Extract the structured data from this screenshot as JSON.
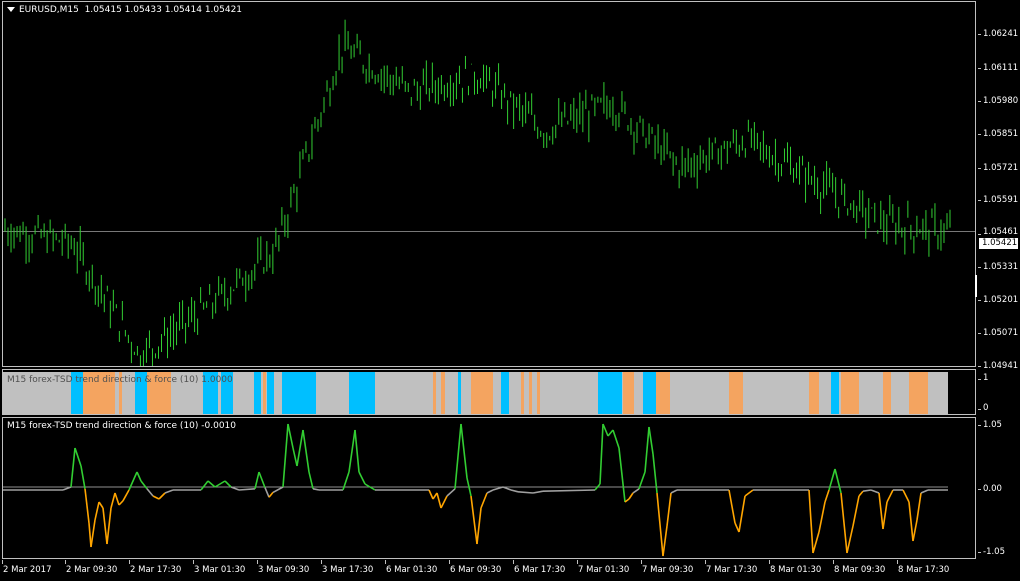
{
  "main_label": {
    "symbol": "EURUSD,M15",
    "ohlc": "1.05415 1.05433 1.05414 1.05421"
  },
  "price_axis": [
    "1.06241",
    "1.06111",
    "1.05980",
    "1.05851",
    "1.05721",
    "1.05591",
    "1.05461",
    "1.05331",
    "1.05201",
    "1.05071",
    "1.04941"
  ],
  "current_price": "1.05421",
  "indicator1": {
    "label": "M15 forex-TSD trend direction & force (10) 1.0000",
    "axis": [
      "1",
      "0"
    ],
    "colors": {
      "neutral": "#c0c0c0",
      "up": "#00bfff",
      "down": "#f4a460"
    }
  },
  "indicator2": {
    "label": "M15 forex-TSD trend direction & force (10) -0.0010",
    "axis": [
      "1.05",
      "0.00",
      "-1.05"
    ],
    "colors": {
      "up": "#32cd32",
      "down": "#ffa500",
      "neutral": "#a0a0a0"
    }
  },
  "time_axis": [
    "2 Mar 2017",
    "2 Mar 09:30",
    "2 Mar 17:30",
    "3 Mar 01:30",
    "3 Mar 09:30",
    "3 Mar 17:30",
    "6 Mar 01:30",
    "6 Mar 09:30",
    "6 Mar 17:30",
    "7 Mar 01:30",
    "7 Mar 09:30",
    "7 Mar 17:30",
    "8 Mar 01:30",
    "8 Mar 09:30",
    "8 Mar 17:30"
  ],
  "colors": {
    "background": "#000000",
    "bars": "#32cd32",
    "grid_border": "#c0c0c0",
    "price_line": "#c0c0c0"
  },
  "chart_data": {
    "type": "line",
    "x": [
      "2 Mar 2017",
      "2 Mar 09:30",
      "2 Mar 17:30",
      "3 Mar 01:30",
      "3 Mar 09:30",
      "3 Mar 17:30",
      "6 Mar 01:30",
      "6 Mar 09:30",
      "6 Mar 17:30",
      "7 Mar 01:30",
      "7 Mar 09:30",
      "7 Mar 17:30",
      "8 Mar 01:30",
      "8 Mar 09:30",
      "8 Mar 17:30"
    ],
    "series": [
      {
        "name": "EURUSD,M15",
        "values": [
          1.0543,
          1.0538,
          1.0498,
          1.0515,
          1.0535,
          1.0608,
          1.0592,
          1.0598,
          1.0578,
          1.0588,
          1.0565,
          1.0575,
          1.056,
          1.0545,
          1.0542
        ]
      }
    ],
    "ylim": [
      1.04941,
      1.06241
    ]
  }
}
